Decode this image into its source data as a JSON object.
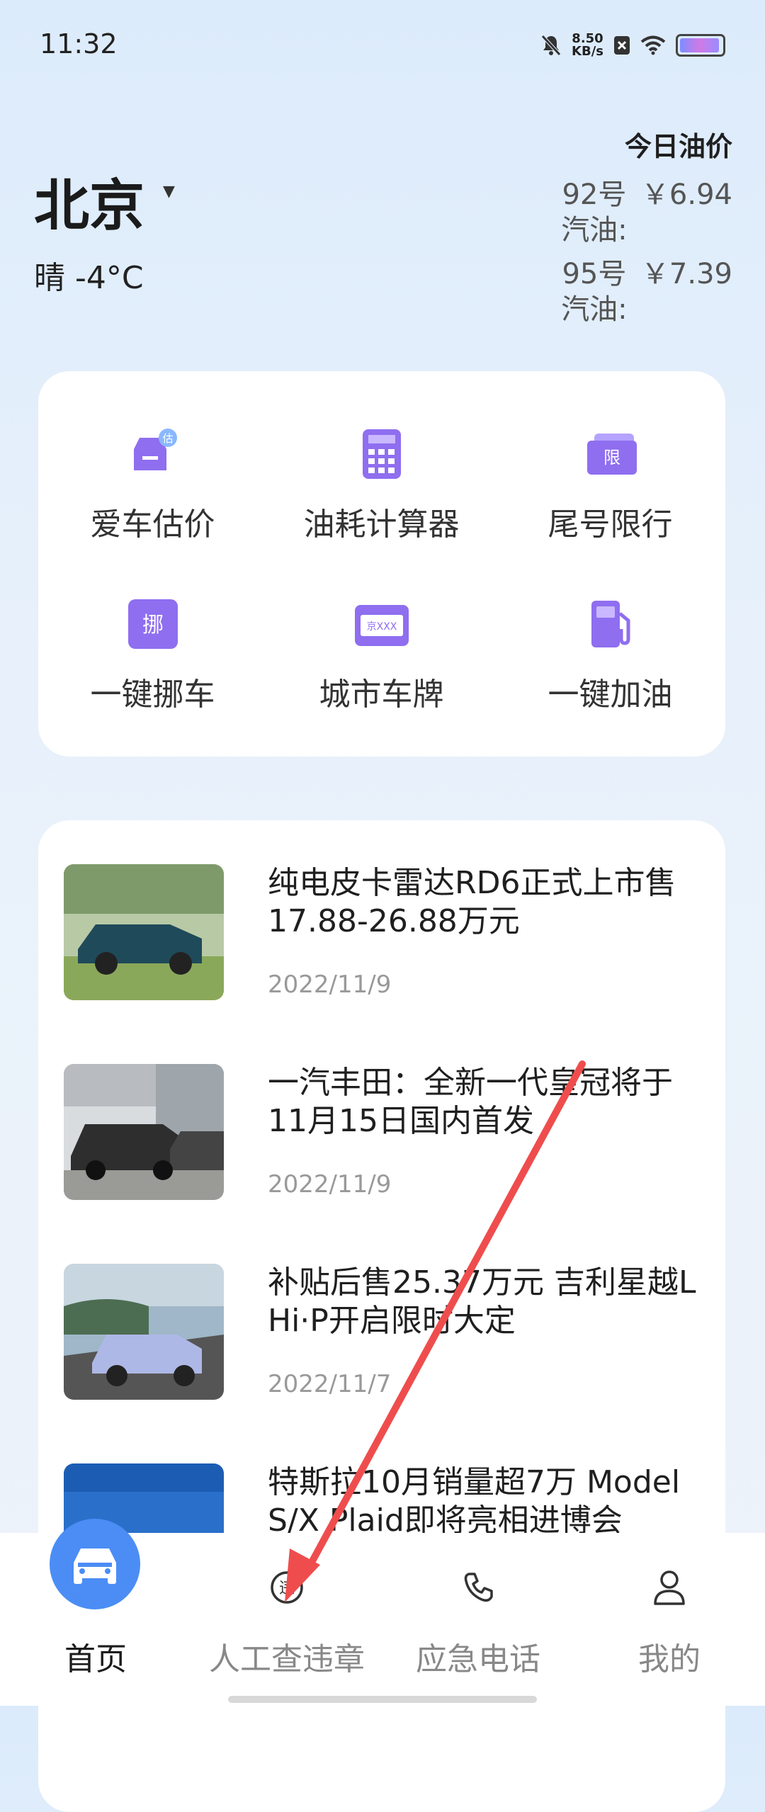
{
  "status_bar": {
    "time": "11:32",
    "speed": "8.50",
    "speed_unit": "KB/s"
  },
  "header": {
    "city": "北京",
    "weather": "晴 -4°C",
    "oil_title": "今日油价",
    "oil_prices": [
      {
        "name": "92号汽油:",
        "price": "￥6.94"
      },
      {
        "name": "95号汽油:",
        "price": "￥7.39"
      }
    ]
  },
  "tools": [
    {
      "label": "爱车估价",
      "icon": "car-valuation-icon",
      "badge": "估"
    },
    {
      "label": "油耗计算器",
      "icon": "calculator-icon"
    },
    {
      "label": "尾号限行",
      "icon": "restriction-icon",
      "badge": "限"
    },
    {
      "label": "一键挪车",
      "icon": "move-car-icon",
      "badge": "挪"
    },
    {
      "label": "城市车牌",
      "icon": "license-plate-icon",
      "badge": "京XXX"
    },
    {
      "label": "一键加油",
      "icon": "fuel-pump-icon"
    }
  ],
  "news": [
    {
      "title": "纯电皮卡雷达RD6正式上市售17.88-26.88万元",
      "date": "2022/11/9"
    },
    {
      "title": "一汽丰田：全新一代皇冠将于11月15日国内首发",
      "date": "2022/11/9"
    },
    {
      "title": "补贴后售25.37万元 吉利星越L Hi·P开启限时大定",
      "date": "2022/11/7"
    },
    {
      "title": "特斯拉10月销量超7万 Model S/X Plaid即将亮相进博会",
      "date": ""
    }
  ],
  "bottom_nav": [
    {
      "label": "首页",
      "icon": "car-icon",
      "active": true
    },
    {
      "label": "人工查违章",
      "icon": "violation-icon",
      "active": false,
      "badge": "违"
    },
    {
      "label": "应急电话",
      "icon": "phone-icon",
      "active": false
    },
    {
      "label": "我的",
      "icon": "user-icon",
      "active": false
    }
  ],
  "colors": {
    "accent": "#4b8df5",
    "tool_icon": "#8f6ef0",
    "arrow": "#ef4d4d"
  }
}
